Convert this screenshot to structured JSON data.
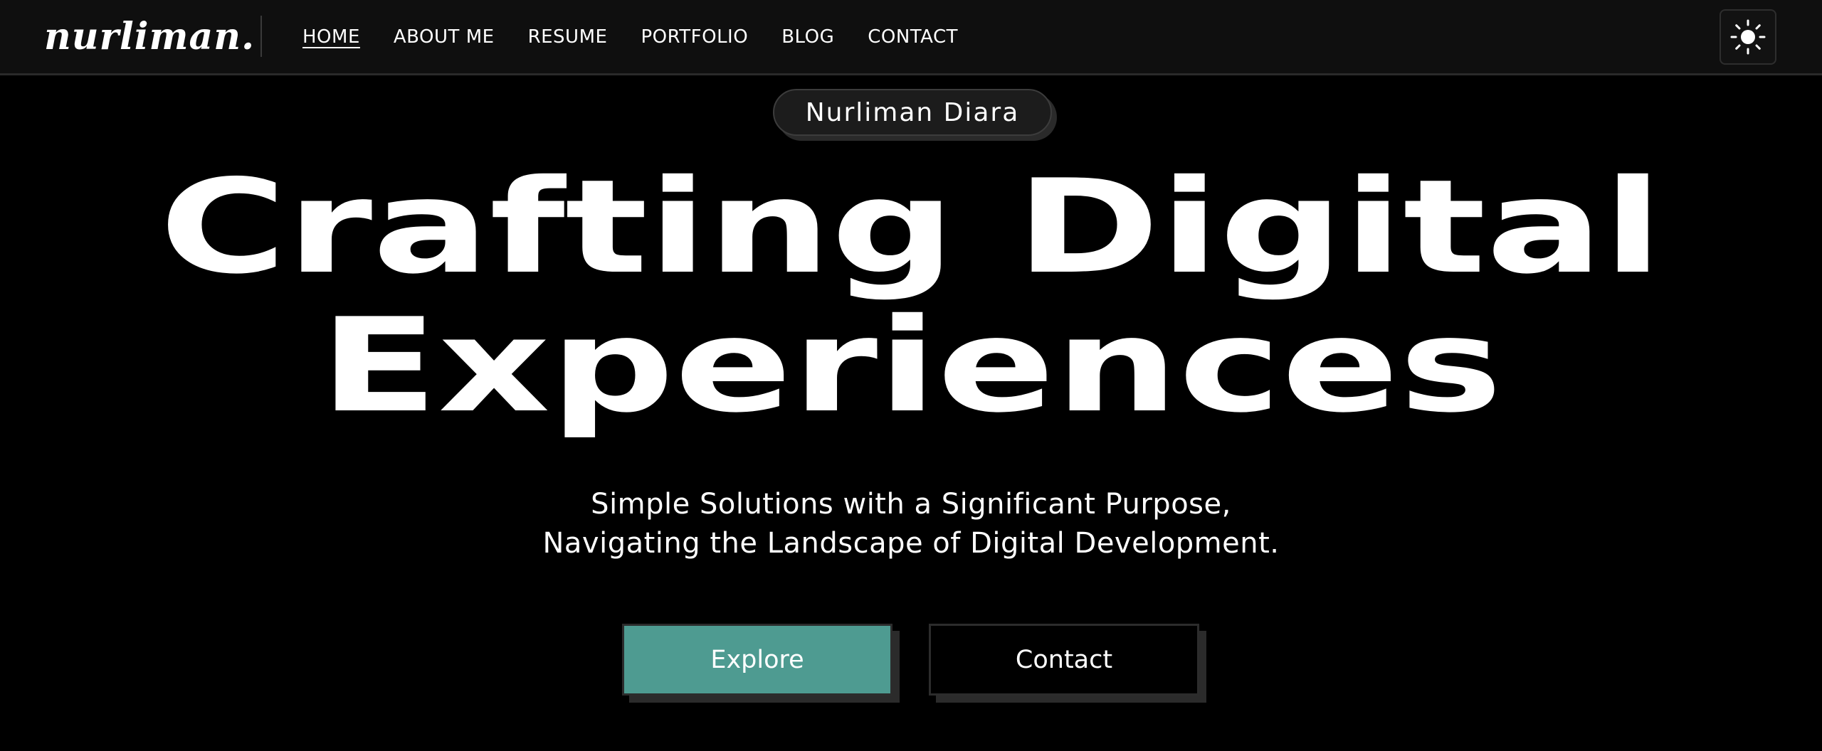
{
  "header": {
    "logo": "nurliman.",
    "nav": [
      {
        "label": "HOME",
        "active": true
      },
      {
        "label": "ABOUT ME",
        "active": false
      },
      {
        "label": "RESUME",
        "active": false
      },
      {
        "label": "PORTFOLIO",
        "active": false
      },
      {
        "label": "BLOG",
        "active": false
      },
      {
        "label": "CONTACT",
        "active": false
      }
    ],
    "theme_toggle_icon": "sun-icon"
  },
  "hero": {
    "name": "Nurliman Diara",
    "title_line1": "Crafting Digital",
    "title_line2": "Experiences",
    "subtitle_line1": "Simple Solutions with a Significant Purpose,",
    "subtitle_line2": "Navigating the Landscape of Digital Development.",
    "explore_label": "Explore",
    "contact_label": "Contact"
  },
  "colors": {
    "background": "#000000",
    "header_bg": "#0f0f0f",
    "accent": "#4e9b91",
    "text": "#ffffff"
  }
}
